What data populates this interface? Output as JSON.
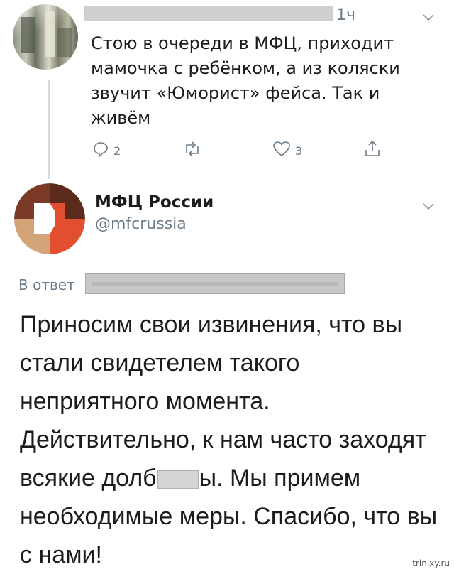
{
  "tweet1": {
    "time": "1ч",
    "text": "Стою в очереди в МФЦ, приходит мамочка с ребёнком, а из коляски звучит «Юморист» фейса. Так и живём",
    "reply_count": "2",
    "like_count": "3"
  },
  "tweet2": {
    "name": "МФЦ России",
    "handle": "@mfcrussia",
    "reply_prefix": "В ответ",
    "text_before_censor": "Приносим свои извинения, что вы стали свидетелем такого неприятного момента. Действительно, к нам часто заходят всякие долб",
    "text_after_censor": "ы. Мы примем необходимые меры. Спасибо, что вы с нами!"
  },
  "watermark": "trinixy.ru",
  "colors": {
    "muted": "#6c7b88",
    "thread_line": "#d3dce3",
    "logo_red": "#e24f30",
    "logo_beige": "#d3a477",
    "logo_brown": "#5a2a1c"
  }
}
